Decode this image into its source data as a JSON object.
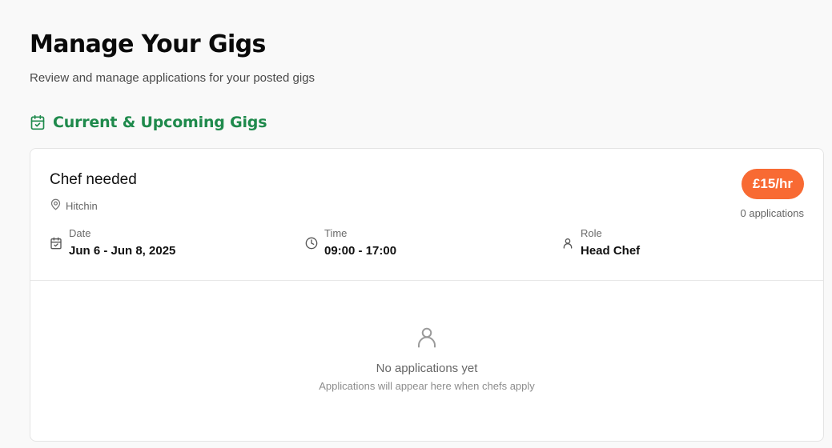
{
  "page": {
    "title": "Manage Your Gigs",
    "subtitle": "Review and manage applications for your posted gigs"
  },
  "section": {
    "title": "Current & Upcoming Gigs",
    "icon": "calendar-check-icon",
    "accent_color": "#1f8a4c"
  },
  "gig": {
    "title": "Chef needed",
    "location": "Hitchin",
    "rate": "£15/hr",
    "rate_color": "#f86a33",
    "applications_count": "0 applications",
    "date": {
      "label": "Date",
      "value": "Jun 6 - Jun 8, 2025"
    },
    "time": {
      "label": "Time",
      "value": "09:00 - 17:00"
    },
    "role": {
      "label": "Role",
      "value": "Head Chef"
    }
  },
  "empty_state": {
    "title": "No applications yet",
    "subtitle": "Applications will appear here when chefs apply"
  }
}
